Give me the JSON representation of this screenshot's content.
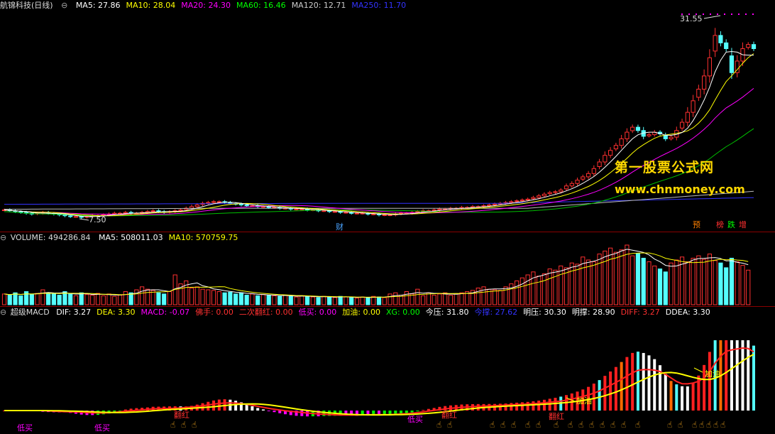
{
  "price": {
    "title": "航锦科技(日线)",
    "ma": [
      {
        "label": "MA5: 27.86",
        "color": "#ffffff"
      },
      {
        "label": "MA10: 28.04",
        "color": "#ffff00"
      },
      {
        "label": "MA20: 24.30",
        "color": "#ff00ff"
      },
      {
        "label": "MA60: 16.46",
        "color": "#00ff00"
      },
      {
        "label": "MA120: 12.71",
        "color": "#cccccc"
      },
      {
        "label": "MA250: 11.70",
        "color": "#3333ff"
      }
    ],
    "high_label": "31.55",
    "low_label": "7.50",
    "event_cai": "财",
    "event_tags": [
      {
        "text": "预",
        "color": "#ff8000"
      },
      {
        "text": "榜",
        "color": "#ff3030"
      },
      {
        "text": "跌",
        "color": "#00ff00"
      },
      {
        "text": "增",
        "color": "#ff3030"
      }
    ],
    "watermark_title": "第一股票公式网",
    "watermark_url": "www.chnmoney.com"
  },
  "volume": {
    "title": "VOLUME: 494286.84",
    "ma": [
      {
        "label": "MA5: 508011.03",
        "color": "#ffffff"
      },
      {
        "label": "MA10: 570759.75",
        "color": "#ffff00"
      }
    ]
  },
  "macd": {
    "title": "超级MACD",
    "fields": [
      {
        "label": "DIF: 3.27",
        "color": "#ffffff"
      },
      {
        "label": "DEA: 3.30",
        "color": "#ffff00"
      },
      {
        "label": "MACD: -0.07",
        "color": "#ff00ff"
      },
      {
        "label": "佛手: 0.00",
        "color": "#ff3030"
      },
      {
        "label": "二次翻红: 0.00",
        "color": "#ff3030"
      },
      {
        "label": "低买: 0.00",
        "color": "#ff00ff"
      },
      {
        "label": "加油: 0.00",
        "color": "#ffff00"
      },
      {
        "label": "XG: 0.00",
        "color": "#00ff00"
      },
      {
        "label": "今压: 31.80",
        "color": "#ffffff"
      },
      {
        "label": "今撑: 27.62",
        "color": "#3333ff"
      },
      {
        "label": "明压: 30.30",
        "color": "#ffffff"
      },
      {
        "label": "明撑: 28.90",
        "color": "#ffffff"
      },
      {
        "label": "DIFF: 3.27",
        "color": "#ff3030"
      },
      {
        "label": "DDEA: 3.30",
        "color": "#ffffff"
      }
    ],
    "annotations": {
      "buy_low": "低买",
      "refuel": "加油",
      "flip_red": "翻红"
    }
  },
  "chart_data": [
    {
      "type": "candlestick",
      "title": "航锦科技(日线)",
      "ylim": [
        7.5,
        31.55
      ],
      "close": [
        8.4,
        8.3,
        8.2,
        8.1,
        8.0,
        7.9,
        8.0,
        8.1,
        8.0,
        7.9,
        7.8,
        7.7,
        7.6,
        7.6,
        7.5,
        7.6,
        7.7,
        7.7,
        7.8,
        7.9,
        8.0,
        8.0,
        8.1,
        8.0,
        8.0,
        8.1,
        8.2,
        8.3,
        8.2,
        8.1,
        8.2,
        8.3,
        8.4,
        8.6,
        8.8,
        9.0,
        9.2,
        9.3,
        9.4,
        9.4,
        9.3,
        9.2,
        9.1,
        9.0,
        8.9,
        8.9,
        8.8,
        8.8,
        8.7,
        8.7,
        8.6,
        8.6,
        8.5,
        8.5,
        8.5,
        8.4,
        8.4,
        8.3,
        8.3,
        8.2,
        8.2,
        8.1,
        8.1,
        8.0,
        8.0,
        8.0,
        7.9,
        7.9,
        7.8,
        7.8,
        7.8,
        7.9,
        8.0,
        8.0,
        8.1,
        8.2,
        8.3,
        8.3,
        8.4,
        8.5,
        8.5,
        8.6,
        8.6,
        8.7,
        8.7,
        8.8,
        8.8,
        8.9,
        9.0,
        9.1,
        9.2,
        9.3,
        9.4,
        9.5,
        9.6,
        9.7,
        9.9,
        10.1,
        10.3,
        10.5,
        10.6,
        10.8,
        11.3,
        11.6,
        12.0,
        12.4,
        12.8,
        13.4,
        14.2,
        15.0,
        15.6,
        16.2,
        17.0,
        17.8,
        18.4,
        18.0,
        17.3,
        17.5,
        17.8,
        17.6,
        17.0,
        17.2,
        18.0,
        19.0,
        20.2,
        21.6,
        23.0,
        24.6,
        26.8,
        29.5,
        28.6,
        27.9,
        25.0,
        26.4,
        27.9,
        28.4,
        27.9
      ]
    },
    {
      "type": "line",
      "series": [
        {
          "name": "MA5",
          "value": 27.86
        },
        {
          "name": "MA10",
          "value": 28.04
        },
        {
          "name": "MA20",
          "value": 24.3
        },
        {
          "name": "MA60",
          "value": 16.46
        },
        {
          "name": "MA120",
          "value": 12.71
        },
        {
          "name": "MA250",
          "value": 11.7
        }
      ]
    },
    {
      "type": "bar",
      "title": "VOLUME",
      "values": [
        0.18,
        0.16,
        0.2,
        0.15,
        0.22,
        0.17,
        0.19,
        0.25,
        0.2,
        0.18,
        0.16,
        0.22,
        0.18,
        0.15,
        0.2,
        0.17,
        0.16,
        0.19,
        0.15,
        0.18,
        0.14,
        0.16,
        0.22,
        0.2,
        0.25,
        0.3,
        0.26,
        0.24,
        0.2,
        0.18,
        0.22,
        0.5,
        0.35,
        0.4,
        0.28,
        0.3,
        0.26,
        0.25,
        0.24,
        0.22,
        0.2,
        0.21,
        0.18,
        0.2,
        0.16,
        0.18,
        0.15,
        0.17,
        0.16,
        0.15,
        0.14,
        0.16,
        0.14,
        0.13,
        0.15,
        0.14,
        0.13,
        0.12,
        0.14,
        0.13,
        0.12,
        0.14,
        0.13,
        0.12,
        0.11,
        0.13,
        0.12,
        0.14,
        0.13,
        0.12,
        0.18,
        0.2,
        0.16,
        0.22,
        0.18,
        0.26,
        0.15,
        0.2,
        0.16,
        0.18,
        0.2,
        0.16,
        0.18,
        0.2,
        0.22,
        0.24,
        0.28,
        0.3,
        0.26,
        0.25,
        0.24,
        0.3,
        0.35,
        0.4,
        0.45,
        0.5,
        0.55,
        0.48,
        0.52,
        0.6,
        0.58,
        0.65,
        0.62,
        0.7,
        0.68,
        0.8,
        0.75,
        0.72,
        0.85,
        0.9,
        0.95,
        0.88,
        0.92,
        1.0,
        0.82,
        0.86,
        0.78,
        0.72,
        0.65,
        0.6,
        0.55,
        0.7,
        0.75,
        0.8,
        0.72,
        0.78,
        0.82,
        0.76,
        0.85,
        0.74,
        0.7,
        0.62,
        0.78,
        0.72,
        0.66,
        0.58
      ],
      "volume": 494286.84,
      "ma5": 508011.03,
      "ma10": 570759.75
    },
    {
      "type": "line",
      "title": "超级MACD",
      "series": [
        {
          "name": "DIF",
          "value": 3.27
        },
        {
          "name": "DEA",
          "value": 3.3
        },
        {
          "name": "MACD",
          "value": -0.07
        }
      ]
    }
  ]
}
